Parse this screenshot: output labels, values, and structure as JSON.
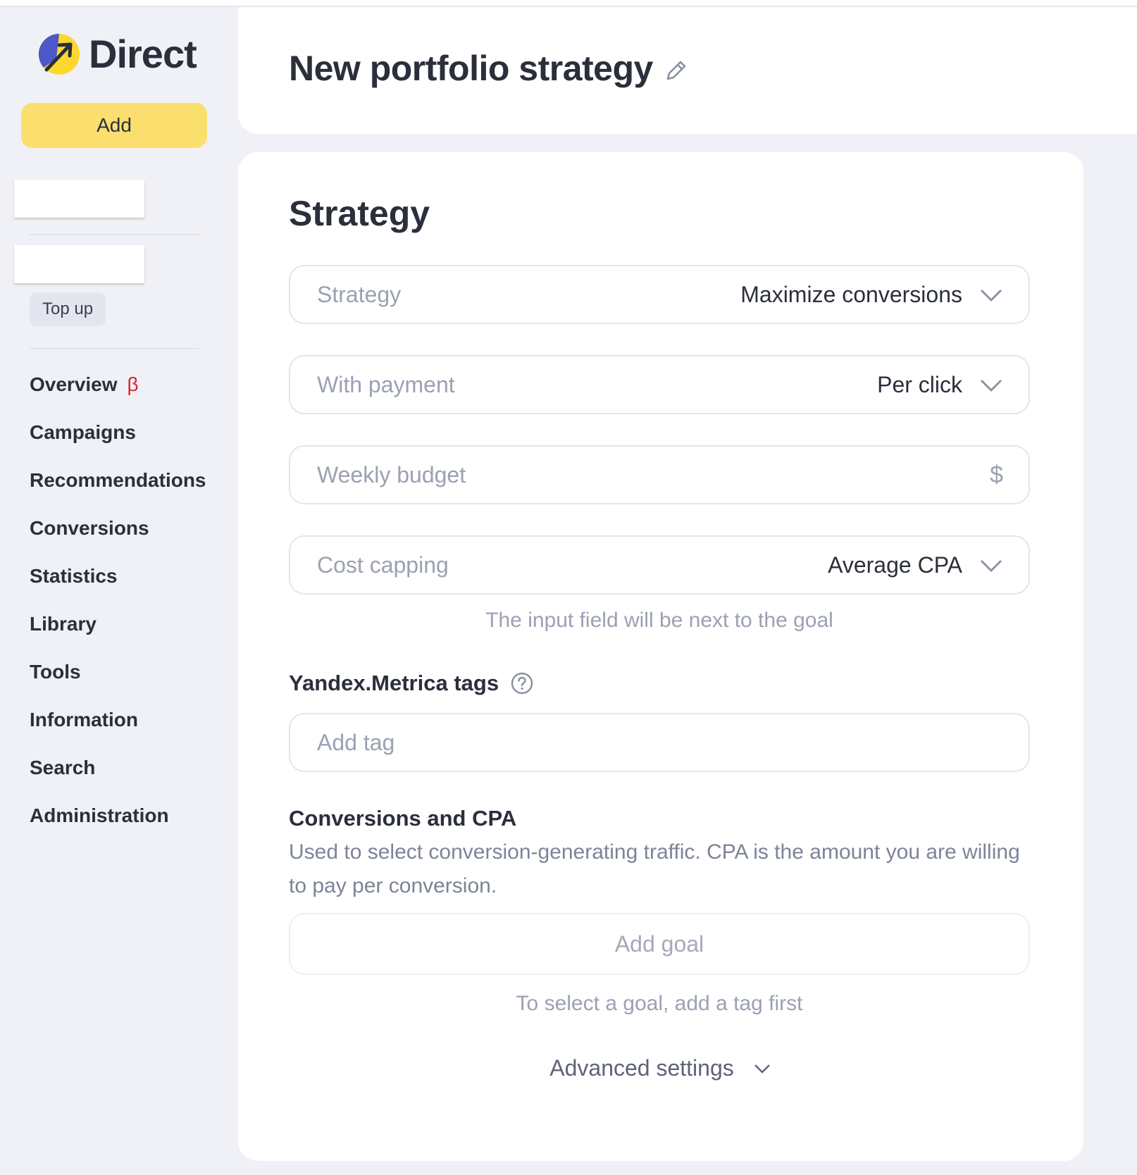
{
  "app": {
    "logo_text": "Direct"
  },
  "sidebar": {
    "add_label": "Add",
    "topup_label": "Top up",
    "nav": [
      {
        "label": "Overview",
        "badge": "β"
      },
      {
        "label": "Campaigns"
      },
      {
        "label": "Recommendations"
      },
      {
        "label": "Conversions"
      },
      {
        "label": "Statistics"
      },
      {
        "label": "Library"
      },
      {
        "label": "Tools"
      },
      {
        "label": "Information"
      },
      {
        "label": "Search"
      },
      {
        "label": "Administration"
      }
    ]
  },
  "header": {
    "title": "New portfolio strategy",
    "edit_icon": "pencil-icon"
  },
  "strategy": {
    "section_title": "Strategy",
    "fields": {
      "strategy": {
        "label": "Strategy",
        "value": "Maximize conversions"
      },
      "payment": {
        "label": "With payment",
        "value": "Per click"
      },
      "budget": {
        "label": "Weekly budget",
        "currency": "$"
      },
      "capping": {
        "label": "Cost capping",
        "value": "Average CPA"
      }
    },
    "capping_hint": "The input field will be next to the goal",
    "tags": {
      "label": "Yandex.Metrica tags",
      "placeholder": "Add tag",
      "help_icon": "question-circle-icon"
    },
    "conversions": {
      "title": "Conversions and CPA",
      "description": "Used to select conversion-generating traffic. CPA is the amount you are willing to pay per conversion.",
      "add_goal_label": "Add goal",
      "goal_hint": "To select a goal, add a tag first"
    },
    "advanced_label": "Advanced settings"
  },
  "colors": {
    "accent": "#fadf6e",
    "background": "#f0f1f6",
    "text": "#2b2f3b",
    "muted": "#9ba1b2",
    "beta": "#d8262e"
  }
}
